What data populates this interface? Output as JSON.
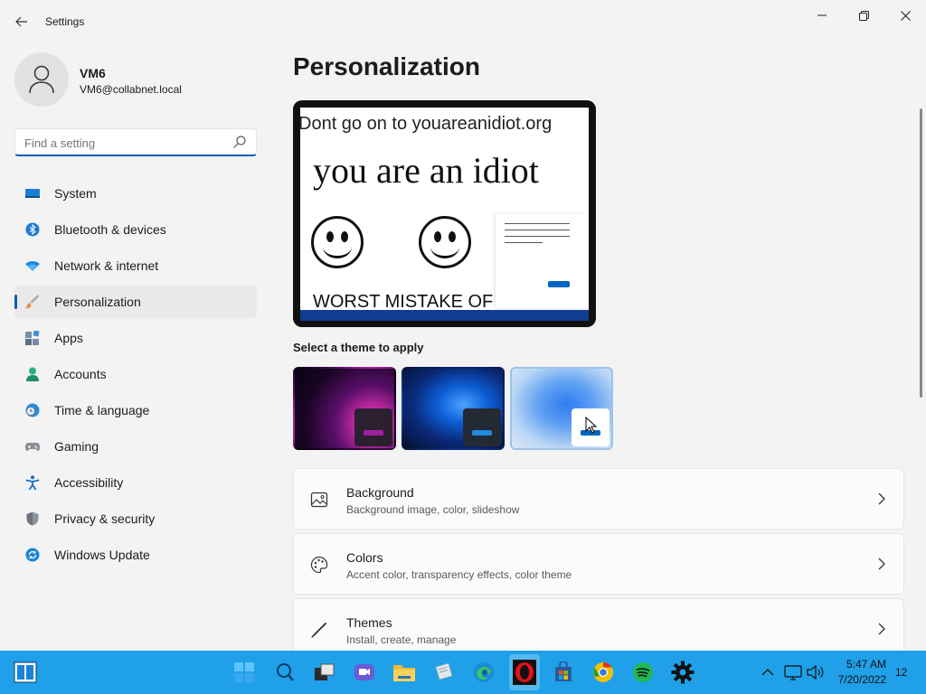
{
  "window": {
    "title": "Settings",
    "controls": [
      "minimize",
      "maximize",
      "close"
    ]
  },
  "profile": {
    "name": "VM6",
    "email": "VM6@collabnet.local"
  },
  "search": {
    "placeholder": "Find a setting",
    "value": ""
  },
  "sidebar": {
    "items": [
      {
        "label": "System",
        "icon": "monitor-icon"
      },
      {
        "label": "Bluetooth & devices",
        "icon": "bluetooth-icon"
      },
      {
        "label": "Network & internet",
        "icon": "wifi-icon"
      },
      {
        "label": "Personalization",
        "icon": "brush-icon",
        "active": true
      },
      {
        "label": "Apps",
        "icon": "apps-icon"
      },
      {
        "label": "Accounts",
        "icon": "person-icon"
      },
      {
        "label": "Time & language",
        "icon": "clock-globe-icon"
      },
      {
        "label": "Gaming",
        "icon": "gamepad-icon"
      },
      {
        "label": "Accessibility",
        "icon": "accessibility-icon"
      },
      {
        "label": "Privacy & security",
        "icon": "shield-icon"
      },
      {
        "label": "Windows Update",
        "icon": "update-icon"
      }
    ]
  },
  "main": {
    "title": "Personalization",
    "preview": {
      "line1": "Dont go on to youareanidiot.org",
      "line2": "you are an idiot",
      "line3": "WORST MISTAKE OF MY LIFE"
    },
    "themes_label": "Select a theme to apply",
    "themes": [
      {
        "name": "Glow (dark purple)",
        "selected": false
      },
      {
        "name": "Windows dark bloom",
        "selected": false
      },
      {
        "name": "Windows light bloom",
        "selected": true
      }
    ],
    "cards": [
      {
        "title": "Background",
        "subtitle": "Background image, color, slideshow",
        "icon": "image-icon"
      },
      {
        "title": "Colors",
        "subtitle": "Accent color, transparency effects, color theme",
        "icon": "palette-icon"
      },
      {
        "title": "Themes",
        "subtitle": "Install, create, manage",
        "icon": "pen-icon"
      }
    ]
  },
  "taskbar": {
    "time": "5:47 AM",
    "date": "7/20/2022",
    "notification_count": "12",
    "accent": "#1fa0e8"
  }
}
